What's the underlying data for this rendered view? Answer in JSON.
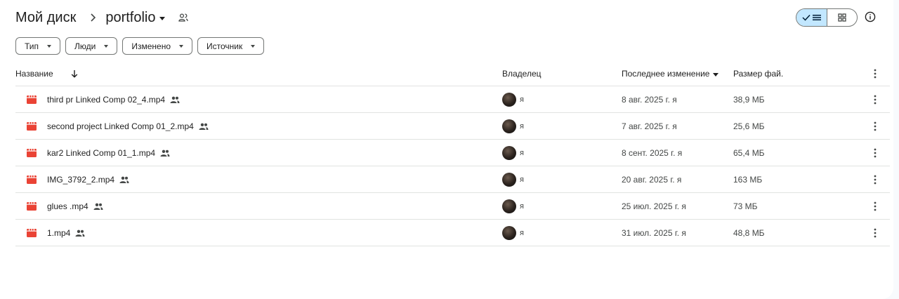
{
  "breadcrumb": {
    "root": "Мой диск",
    "current": "portfolio"
  },
  "filters": [
    "Тип",
    "Люди",
    "Изменено",
    "Источник"
  ],
  "columns": {
    "name": "Название",
    "owner": "Владелец",
    "modified": "Последнее изменение",
    "size": "Размер фай."
  },
  "files": [
    {
      "name": "third pr Linked Comp 02_4.mp4",
      "owner": "я",
      "modified": "8 авг. 2025 г. я",
      "size": "38,9 МБ"
    },
    {
      "name": "second project Linked Comp 01_2.mp4",
      "owner": "я",
      "modified": "7 авг. 2025 г. я",
      "size": "25,6 МБ"
    },
    {
      "name": "kar2 Linked Comp 01_1.mp4",
      "owner": "я",
      "modified": "8 сент. 2025 г. я",
      "size": "65,4 МБ"
    },
    {
      "name": "IMG_3792_2.mp4",
      "owner": "я",
      "modified": "20 авг. 2025 г. я",
      "size": "163 МБ"
    },
    {
      "name": "glues .mp4",
      "owner": "я",
      "modified": "25 июл. 2025 г. я",
      "size": "73 МБ"
    },
    {
      "name": "1.mp4",
      "owner": "я",
      "modified": "31 июл. 2025 г. я",
      "size": "48,8 МБ"
    }
  ],
  "colors": {
    "accent": "#c2e7ff",
    "video_icon": "#ea4335",
    "divider": "#e1e3e1"
  },
  "icons": {
    "sort": "arrow-down-icon",
    "view_list": "list-icon",
    "view_grid": "grid-icon",
    "info": "info-icon",
    "file": "video-file-icon",
    "shared": "people-icon"
  }
}
